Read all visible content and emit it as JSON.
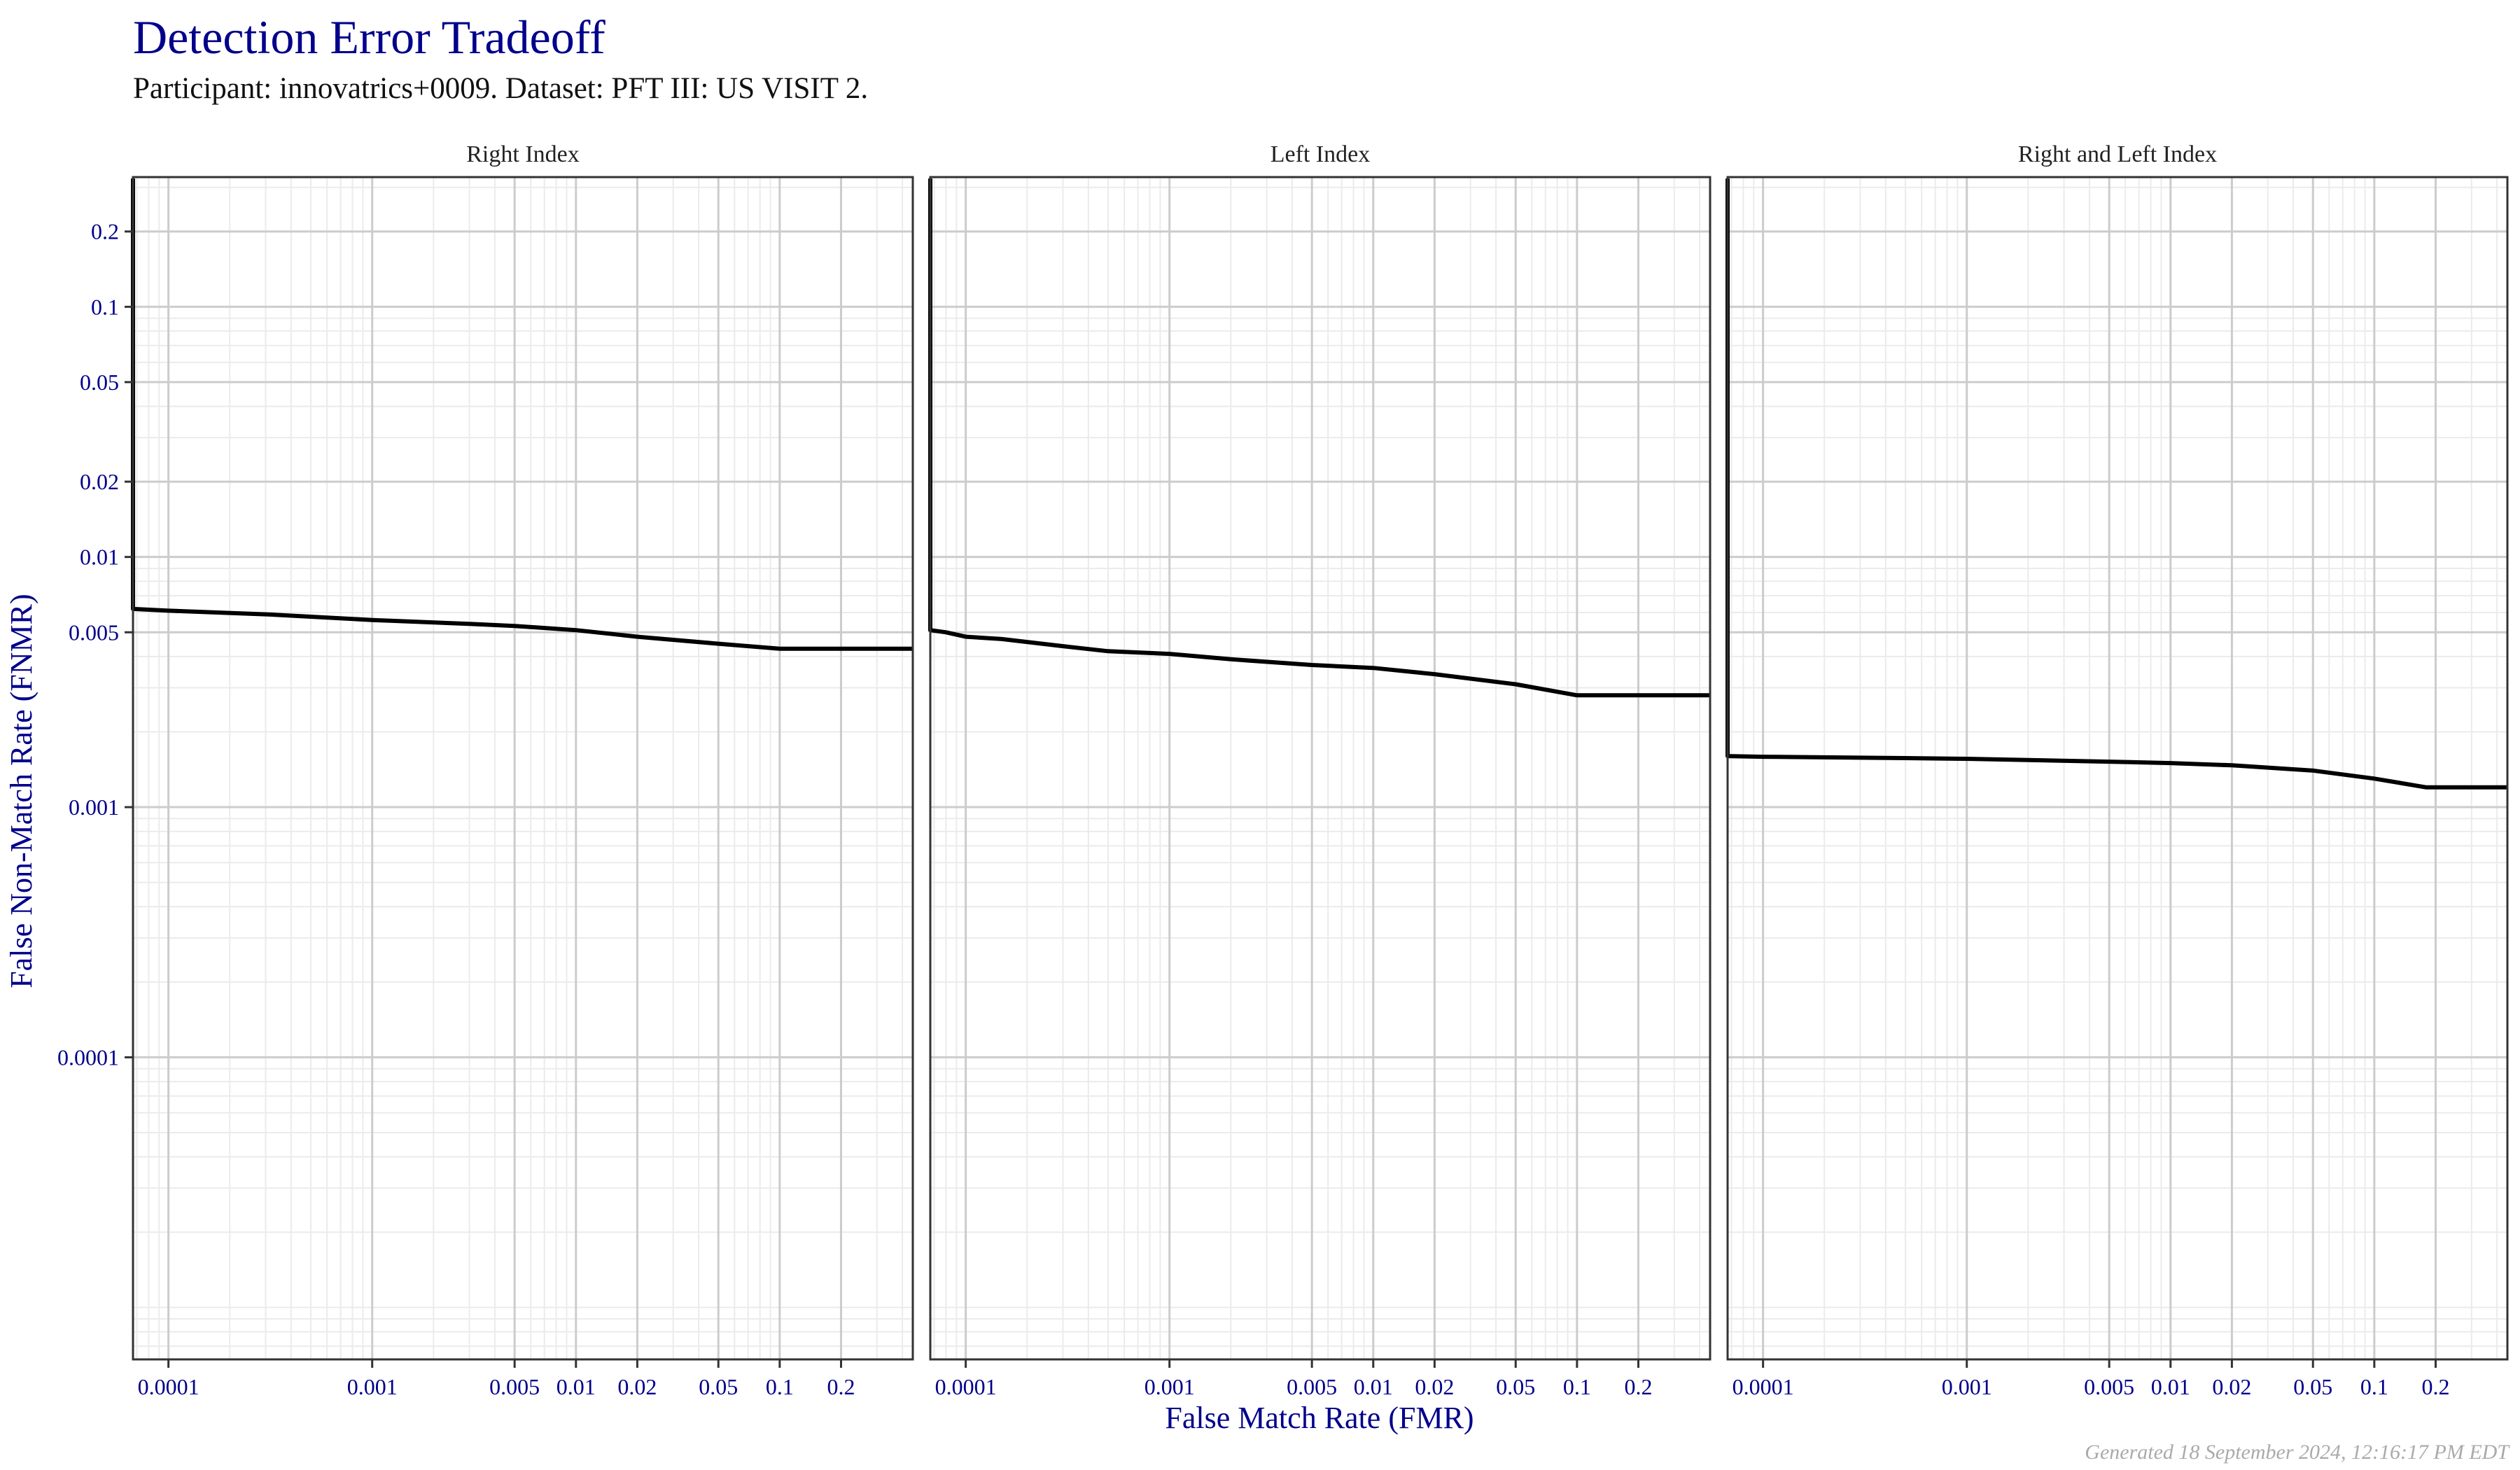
{
  "header": {
    "title": "Detection Error Tradeoff",
    "subtitle": "Participant: innovatrics+0009. Dataset: PFT III: US VISIT 2."
  },
  "footer": "Generated 18 September 2024, 12:16:17 PM EDT",
  "colors": {
    "axis_text": "#00008B",
    "line": "#000000",
    "grid_major": "#cccccc",
    "grid_minor": "#ebebeb",
    "footer": "#aaaaaa"
  },
  "chart_data": {
    "type": "line",
    "title": "Detection Error Tradeoff",
    "subtitle": "Participant: innovatrics+0009. Dataset: PFT III: US VISIT 2.",
    "xlabel": "False Match Rate (FMR)",
    "ylabel": "False Non-Match Rate (FNMR)",
    "xscale": "log",
    "yscale": "log",
    "xlim": [
      6.7e-05,
      0.45
    ],
    "ylim": [
      6.2e-06,
      0.33
    ],
    "grid": true,
    "x_ticks": [
      0.0001,
      0.001,
      0.005,
      0.01,
      0.02,
      0.05,
      0.1,
      0.2
    ],
    "x_tick_labels": [
      "0.0001",
      "0.001",
      "0.005",
      "0.01",
      "0.02",
      "0.05",
      "0.1",
      "0.2"
    ],
    "y_ticks": [
      0.2,
      0.1,
      0.05,
      0.02,
      0.01,
      0.005,
      0.001,
      0.0001
    ],
    "y_tick_labels": [
      "0.2",
      "0.1",
      "0.05",
      "0.02",
      "0.01",
      "0.005",
      "0.001",
      "0.0001"
    ],
    "panels": [
      {
        "name": "Right Index",
        "series": [
          {
            "name": "innovatrics+0009",
            "x": [
              6.7e-05,
              0.0001,
              0.0003,
              0.001,
              0.003,
              0.005,
              0.01,
              0.02,
              0.05,
              0.1,
              0.2,
              0.45
            ],
            "y": [
              0.0062,
              0.0061,
              0.0059,
              0.0056,
              0.0054,
              0.0053,
              0.0051,
              0.0048,
              0.0045,
              0.0043,
              0.0043,
              0.0043
            ]
          }
        ]
      },
      {
        "name": "Left Index",
        "series": [
          {
            "name": "innovatrics+0009",
            "x": [
              6.7e-05,
              8e-05,
              0.0001,
              0.00015,
              0.0003,
              0.0005,
              0.001,
              0.002,
              0.005,
              0.01,
              0.02,
              0.05,
              0.1,
              0.2,
              0.45
            ],
            "y": [
              0.0051,
              0.005,
              0.0048,
              0.0047,
              0.0044,
              0.0042,
              0.0041,
              0.0039,
              0.0037,
              0.0036,
              0.0034,
              0.0031,
              0.0028,
              0.0028,
              0.0028
            ]
          }
        ]
      },
      {
        "name": "Right and Left Index",
        "series": [
          {
            "name": "innovatrics+0009",
            "x": [
              6.7e-05,
              0.0001,
              0.0005,
              0.001,
              0.005,
              0.01,
              0.02,
              0.05,
              0.1,
              0.18,
              0.45
            ],
            "y": [
              0.0016,
              0.00159,
              0.00157,
              0.00156,
              0.00152,
              0.0015,
              0.00147,
              0.0014,
              0.0013,
              0.0012,
              0.0012
            ]
          }
        ]
      }
    ]
  }
}
